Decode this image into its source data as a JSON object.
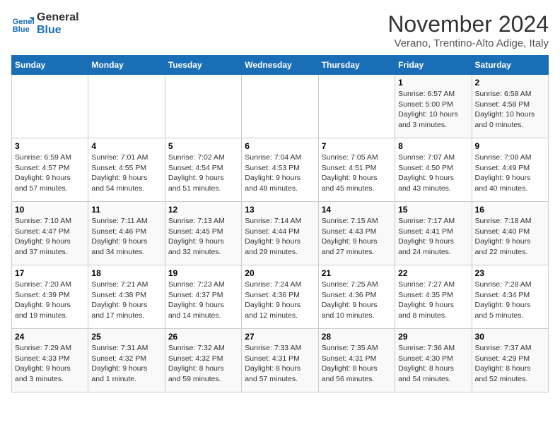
{
  "logo": {
    "line1": "General",
    "line2": "Blue"
  },
  "title": "November 2024",
  "location": "Verano, Trentino-Alto Adige, Italy",
  "days_of_week": [
    "Sunday",
    "Monday",
    "Tuesday",
    "Wednesday",
    "Thursday",
    "Friday",
    "Saturday"
  ],
  "weeks": [
    [
      {
        "day": "",
        "info": ""
      },
      {
        "day": "",
        "info": ""
      },
      {
        "day": "",
        "info": ""
      },
      {
        "day": "",
        "info": ""
      },
      {
        "day": "",
        "info": ""
      },
      {
        "day": "1",
        "info": "Sunrise: 6:57 AM\nSunset: 5:00 PM\nDaylight: 10 hours\nand 3 minutes."
      },
      {
        "day": "2",
        "info": "Sunrise: 6:58 AM\nSunset: 4:58 PM\nDaylight: 10 hours\nand 0 minutes."
      }
    ],
    [
      {
        "day": "3",
        "info": "Sunrise: 6:59 AM\nSunset: 4:57 PM\nDaylight: 9 hours\nand 57 minutes."
      },
      {
        "day": "4",
        "info": "Sunrise: 7:01 AM\nSunset: 4:55 PM\nDaylight: 9 hours\nand 54 minutes."
      },
      {
        "day": "5",
        "info": "Sunrise: 7:02 AM\nSunset: 4:54 PM\nDaylight: 9 hours\nand 51 minutes."
      },
      {
        "day": "6",
        "info": "Sunrise: 7:04 AM\nSunset: 4:53 PM\nDaylight: 9 hours\nand 48 minutes."
      },
      {
        "day": "7",
        "info": "Sunrise: 7:05 AM\nSunset: 4:51 PM\nDaylight: 9 hours\nand 45 minutes."
      },
      {
        "day": "8",
        "info": "Sunrise: 7:07 AM\nSunset: 4:50 PM\nDaylight: 9 hours\nand 43 minutes."
      },
      {
        "day": "9",
        "info": "Sunrise: 7:08 AM\nSunset: 4:49 PM\nDaylight: 9 hours\nand 40 minutes."
      }
    ],
    [
      {
        "day": "10",
        "info": "Sunrise: 7:10 AM\nSunset: 4:47 PM\nDaylight: 9 hours\nand 37 minutes."
      },
      {
        "day": "11",
        "info": "Sunrise: 7:11 AM\nSunset: 4:46 PM\nDaylight: 9 hours\nand 34 minutes."
      },
      {
        "day": "12",
        "info": "Sunrise: 7:13 AM\nSunset: 4:45 PM\nDaylight: 9 hours\nand 32 minutes."
      },
      {
        "day": "13",
        "info": "Sunrise: 7:14 AM\nSunset: 4:44 PM\nDaylight: 9 hours\nand 29 minutes."
      },
      {
        "day": "14",
        "info": "Sunrise: 7:15 AM\nSunset: 4:43 PM\nDaylight: 9 hours\nand 27 minutes."
      },
      {
        "day": "15",
        "info": "Sunrise: 7:17 AM\nSunset: 4:41 PM\nDaylight: 9 hours\nand 24 minutes."
      },
      {
        "day": "16",
        "info": "Sunrise: 7:18 AM\nSunset: 4:40 PM\nDaylight: 9 hours\nand 22 minutes."
      }
    ],
    [
      {
        "day": "17",
        "info": "Sunrise: 7:20 AM\nSunset: 4:39 PM\nDaylight: 9 hours\nand 19 minutes."
      },
      {
        "day": "18",
        "info": "Sunrise: 7:21 AM\nSunset: 4:38 PM\nDaylight: 9 hours\nand 17 minutes."
      },
      {
        "day": "19",
        "info": "Sunrise: 7:23 AM\nSunset: 4:37 PM\nDaylight: 9 hours\nand 14 minutes."
      },
      {
        "day": "20",
        "info": "Sunrise: 7:24 AM\nSunset: 4:36 PM\nDaylight: 9 hours\nand 12 minutes."
      },
      {
        "day": "21",
        "info": "Sunrise: 7:25 AM\nSunset: 4:36 PM\nDaylight: 9 hours\nand 10 minutes."
      },
      {
        "day": "22",
        "info": "Sunrise: 7:27 AM\nSunset: 4:35 PM\nDaylight: 9 hours\nand 8 minutes."
      },
      {
        "day": "23",
        "info": "Sunrise: 7:28 AM\nSunset: 4:34 PM\nDaylight: 9 hours\nand 5 minutes."
      }
    ],
    [
      {
        "day": "24",
        "info": "Sunrise: 7:29 AM\nSunset: 4:33 PM\nDaylight: 9 hours\nand 3 minutes."
      },
      {
        "day": "25",
        "info": "Sunrise: 7:31 AM\nSunset: 4:32 PM\nDaylight: 9 hours\nand 1 minute."
      },
      {
        "day": "26",
        "info": "Sunrise: 7:32 AM\nSunset: 4:32 PM\nDaylight: 8 hours\nand 59 minutes."
      },
      {
        "day": "27",
        "info": "Sunrise: 7:33 AM\nSunset: 4:31 PM\nDaylight: 8 hours\nand 57 minutes."
      },
      {
        "day": "28",
        "info": "Sunrise: 7:35 AM\nSunset: 4:31 PM\nDaylight: 8 hours\nand 56 minutes."
      },
      {
        "day": "29",
        "info": "Sunrise: 7:36 AM\nSunset: 4:30 PM\nDaylight: 8 hours\nand 54 minutes."
      },
      {
        "day": "30",
        "info": "Sunrise: 7:37 AM\nSunset: 4:29 PM\nDaylight: 8 hours\nand 52 minutes."
      }
    ]
  ]
}
